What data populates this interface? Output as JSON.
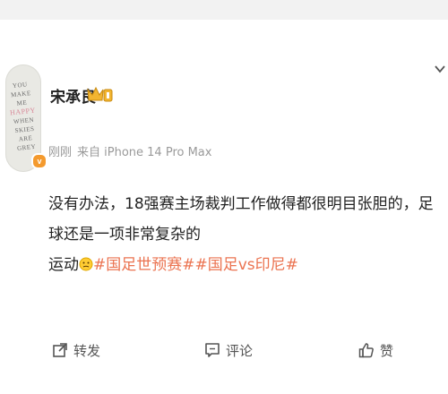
{
  "post": {
    "author": {
      "name": "宋承良",
      "avatar_text": [
        "YOU MAKE",
        "ME",
        "HAPPY",
        "WHEN",
        "SKIES",
        "ARE",
        "GREY"
      ],
      "verified": true
    },
    "meta": {
      "time": "刚刚",
      "source": "来自 iPhone 14 Pro Max"
    },
    "text_line1": "没有办法，18强赛主场裁判工作做得都很明目张胆的，足球还是一项非常复杂的",
    "text_line2_prefix": "运动",
    "tags": [
      "#国足世预赛#",
      "#国足vs印尼#"
    ]
  },
  "actions": {
    "repost_label": "转发",
    "comment_label": "评论",
    "like_label": "赞"
  },
  "colors": {
    "tag": "#eb7350",
    "meta": "#9a9a9a",
    "badge": "#f49a2e",
    "crown": "#f2b531"
  }
}
